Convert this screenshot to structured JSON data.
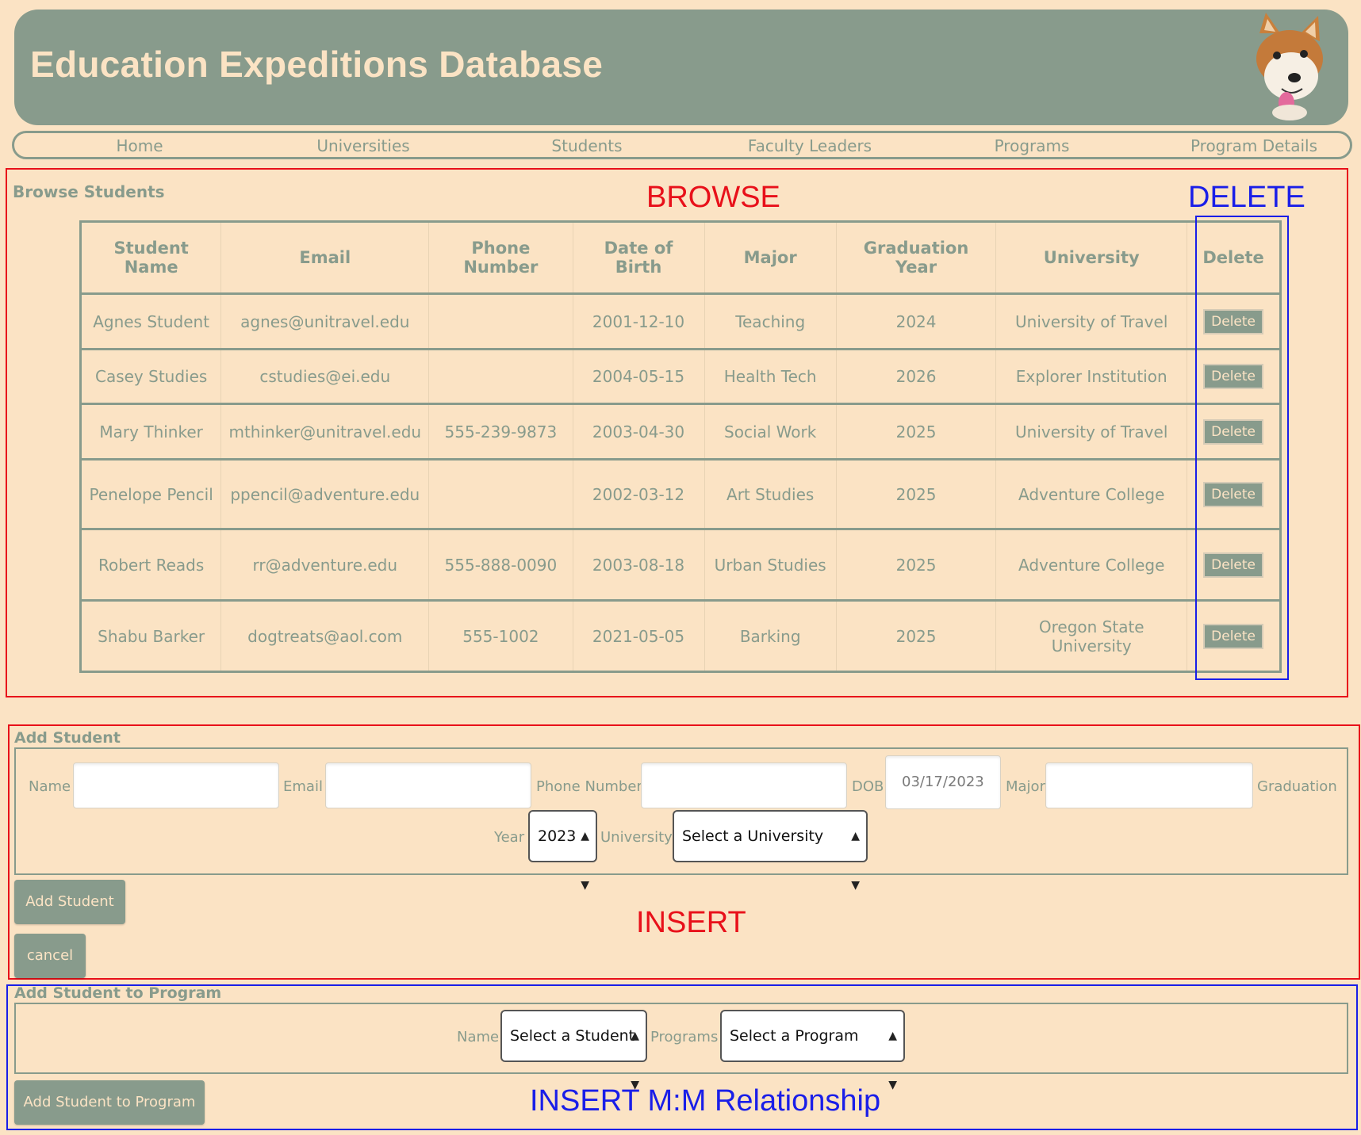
{
  "header": {
    "title": "Education Expeditions Database"
  },
  "nav": [
    "Home",
    "Universities",
    "Students",
    "Faculty Leaders",
    "Programs",
    "Program Details"
  ],
  "annotations": {
    "browse": "BROWSE",
    "delete": "DELETE",
    "insert": "INSERT",
    "insert_mm": "INSERT M:M Relationship"
  },
  "browse": {
    "title": "Browse Students",
    "headers": [
      "Student Name",
      "Email",
      "Phone Number",
      "Date of Birth",
      "Major",
      "Graduation Year",
      "University",
      "Delete"
    ],
    "rows": [
      [
        "Agnes Student",
        "agnes@unitravel.edu",
        "",
        "2001-12-10",
        "Teaching",
        "2024",
        "University of Travel"
      ],
      [
        "Casey Studies",
        "cstudies@ei.edu",
        "",
        "2004-05-15",
        "Health Tech",
        "2026",
        "Explorer Institution"
      ],
      [
        "Mary Thinker",
        "mthinker@unitravel.edu",
        "555-239-9873",
        "2003-04-30",
        "Social Work",
        "2025",
        "University of Travel"
      ],
      [
        "Penelope Pencil",
        "ppencil@adventure.edu",
        "",
        "2002-03-12",
        "Art Studies",
        "2025",
        "Adventure College"
      ],
      [
        "Robert Reads",
        "rr@adventure.edu",
        "555-888-0090",
        "2003-08-18",
        "Urban Studies",
        "2025",
        "Adventure College"
      ],
      [
        "Shabu Barker",
        "dogtreats@aol.com",
        "555-1002",
        "2021-05-05",
        "Barking",
        "2025",
        "Oregon State University"
      ]
    ],
    "delete_label": "Delete"
  },
  "add_student": {
    "title": "Add Student",
    "name_label": "Name",
    "email_label": "Email",
    "phone_label": "Phone Number",
    "dob_label": "DOB",
    "dob_value": "03/17/2023",
    "major_label": "Major",
    "grad_label_1": "Graduation",
    "grad_label_2": "Year",
    "grad_value": "2023",
    "university_label": "University",
    "university_value": "Select a University",
    "submit_label": "Add Student",
    "cancel_label": "cancel"
  },
  "add_to_program": {
    "title": "Add Student to Program",
    "name_label": "Name",
    "student_value": "Select a Student",
    "programs_label": "Programs",
    "program_value": "Select a Program",
    "submit_label": "Add Student to Program"
  }
}
